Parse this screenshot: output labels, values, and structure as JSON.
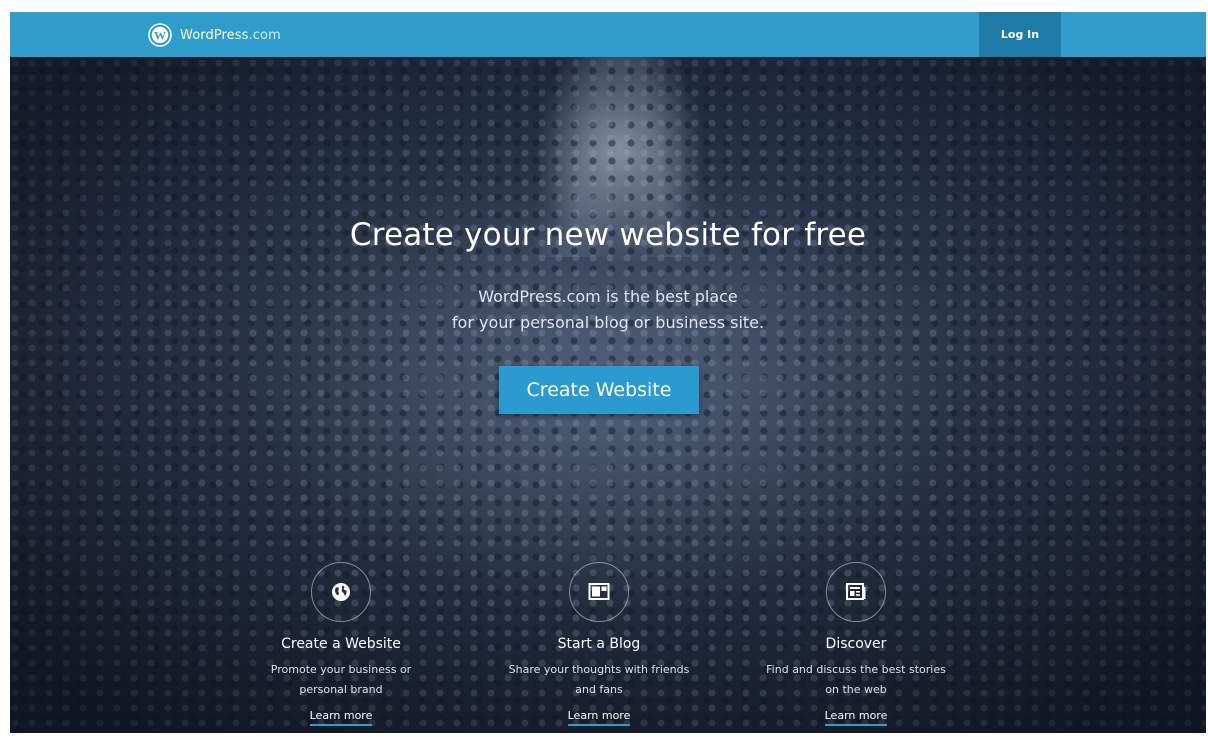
{
  "header": {
    "brand_name": "WordPress",
    "brand_tld": ".com",
    "login_label": "Log In"
  },
  "hero": {
    "headline": "Create your new website for free",
    "subtitle_line1": "WordPress.com is the best place",
    "subtitle_line2": "for your personal blog or business site.",
    "cta_label": "Create Website"
  },
  "features": [
    {
      "icon": "globe-icon",
      "title": "Create a Website",
      "description_line1": "Promote your business or",
      "description_line2": "personal brand",
      "link": "Learn more"
    },
    {
      "icon": "blog-layout-icon",
      "title": "Start a Blog",
      "description_line1": "Share your thoughts with friends",
      "description_line2": "and fans",
      "link": "Learn more"
    },
    {
      "icon": "reader-icon",
      "title": "Discover",
      "description_line1": "Find and discuss the best stories",
      "description_line2": "on the web",
      "link": "Learn more"
    }
  ],
  "colors": {
    "brand_blue": "#2f9ccb",
    "login_bg": "#1f7aa8",
    "cta_bg": "#2b9ad0",
    "hero_dark": "#1c2535"
  }
}
